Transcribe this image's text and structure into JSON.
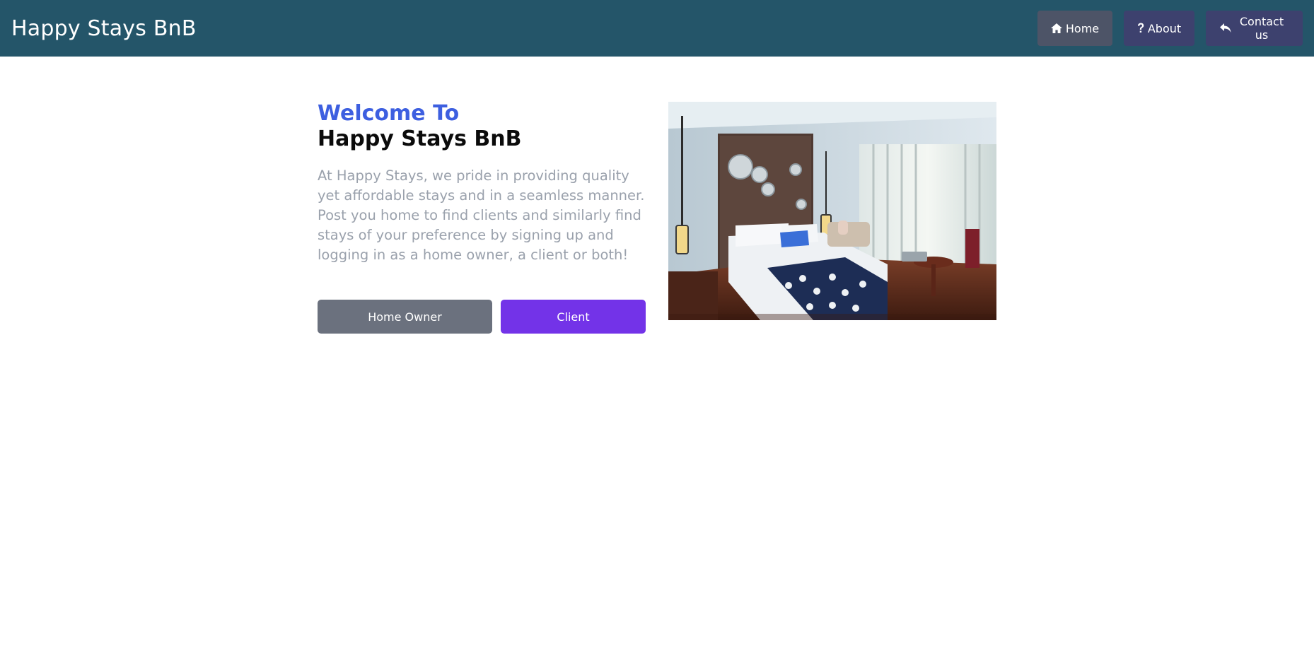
{
  "navbar": {
    "brand": "Happy Stays BnB",
    "items": [
      {
        "label": "Home",
        "icon": "home-icon"
      },
      {
        "label": "About",
        "icon": "question-icon"
      },
      {
        "label": "Contact us",
        "icon": "reply-icon"
      }
    ]
  },
  "hero": {
    "welcome": "Welcome To",
    "title": "Happy Stays BnB",
    "intro": "At Happy Stays, we pride in providing quality yet affordable stays and in a seamless manner. Post you home to find clients and similarly find stays of your preference by signing up and logging in as a home owner, a client or both!",
    "owner_label": "Home Owner",
    "client_label": "Client",
    "image": "hotel-bedroom-photo"
  },
  "colors": {
    "navbar": "#245569",
    "welcome": "#3d5fe0",
    "client_button": "#7333e8",
    "owner_button": "#6b717e"
  }
}
